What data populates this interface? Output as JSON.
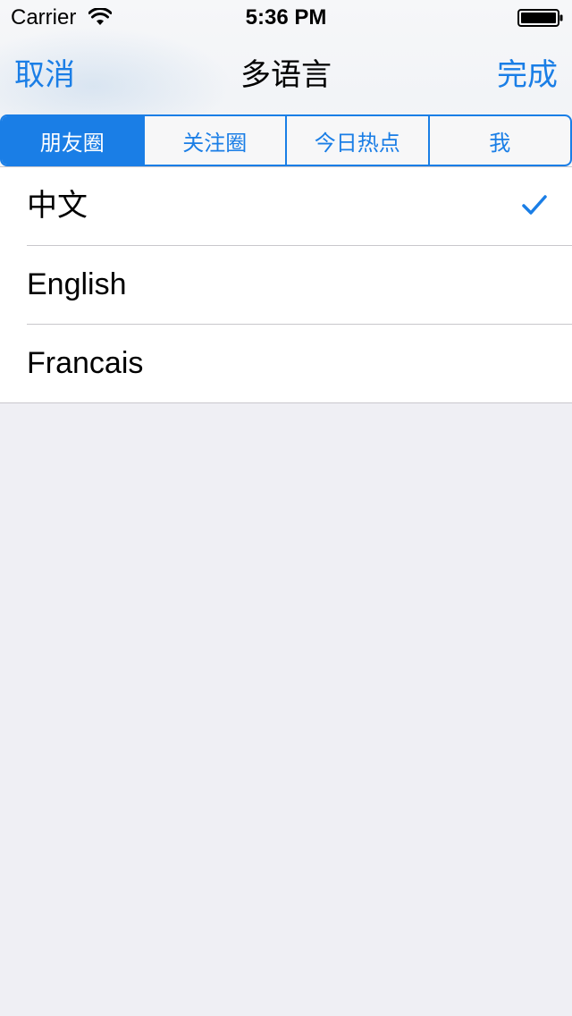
{
  "status_bar": {
    "carrier": "Carrier",
    "time": "5:36 PM"
  },
  "nav": {
    "cancel_label": "取消",
    "title": "多语言",
    "done_label": "完成"
  },
  "segments": [
    {
      "label": "朋友圈",
      "selected": true
    },
    {
      "label": "关注圈",
      "selected": false
    },
    {
      "label": "今日热点",
      "selected": false
    },
    {
      "label": "我",
      "selected": false
    }
  ],
  "languages": [
    {
      "label": "中文",
      "checked": true
    },
    {
      "label": "English",
      "checked": false
    },
    {
      "label": "Francais",
      "checked": false
    }
  ],
  "colors": {
    "accent": "#1a7ee6",
    "background": "#efeff4"
  },
  "icons": {
    "wifi": "wifi-icon",
    "battery": "battery-icon",
    "check": "checkmark-icon"
  }
}
